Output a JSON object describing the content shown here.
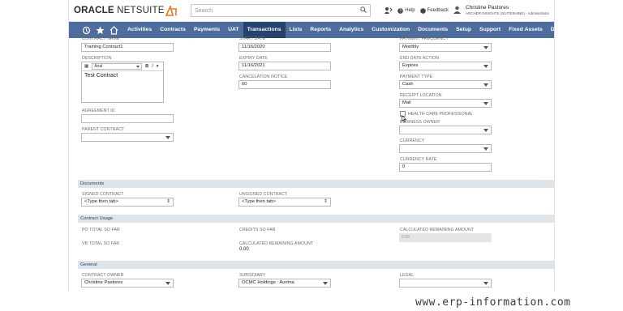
{
  "topbar": {
    "logo_main": "ORACLE",
    "logo_sub": "NETSUITE",
    "search_placeholder": "Search",
    "help_label": "Help",
    "feedback_label": "Feedback",
    "user_name": "Christine Pastores",
    "user_role": "ARCHER INSIGHTS (SUITESHINE) - Administrator"
  },
  "nav": {
    "items": [
      "Activities",
      "Contracts",
      "Payments",
      "UAT",
      "Transactions",
      "Lists",
      "Reports",
      "Analytics",
      "Customization",
      "Documents",
      "Setup",
      "Support",
      "Fixed Assets",
      "Demo Framework",
      "..."
    ],
    "active_index": 4,
    "colors": {
      "bar": "#4d6d9f",
      "active": "#26436e"
    }
  },
  "form": {
    "contract_name": {
      "label": "CONTRACT NAME",
      "value": "Training Contract1"
    },
    "description": {
      "label": "DESCRIPTION",
      "font": "Arial",
      "bold": "B",
      "italic": "I",
      "text": "Test Contract"
    },
    "agreement_id": {
      "label": "AGREEMENT ID",
      "value": ""
    },
    "parent_contract": {
      "label": "PARENT CONTRACT",
      "value": ""
    },
    "start_date": {
      "label": "START DATE",
      "value": "11/16/2020"
    },
    "expiry_date": {
      "label": "EXPIRY DATE",
      "value": "11/16/2021"
    },
    "cancelation_notice": {
      "label": "CANCELATION NOTICE",
      "value": "60"
    },
    "payment_frequency": {
      "label": "PAYMENT FREQUENCY",
      "value": "Monthly"
    },
    "end_date_action": {
      "label": "END DATE ACTION",
      "value": "Expires"
    },
    "payment_type": {
      "label": "PAYMENT TYPE",
      "value": "Cash"
    },
    "receipt_location": {
      "label": "RECEIPT LOCATION",
      "value": "Mail"
    },
    "health_care_professional": {
      "label": "HEALTH CARE PROFESSIONAL"
    },
    "business_owner": {
      "label": "BUSINESS OWNER",
      "value": ""
    },
    "currency": {
      "label": "CURRENCY",
      "value": ""
    },
    "currency_rate": {
      "label": "CURRENCY RATE",
      "value": "0"
    }
  },
  "documents": {
    "title": "Documents",
    "signed_contract": {
      "label": "SIGNED CONTRACT",
      "value": "<Type then tab>"
    },
    "unsigned_contract": {
      "label": "UNSIGNED CONTRACT",
      "value": "<Type then tab>"
    }
  },
  "contract_usage": {
    "title": "Contract Usage",
    "po_total": {
      "label": "PO TOTAL SO FAR"
    },
    "vb_total": {
      "label": "VB TOTAL SO FAR"
    },
    "credits": {
      "label": "CREDITS SO FAR"
    },
    "calc_remaining_1": {
      "label": "CALCULATED REMAINING AMOUNT",
      "value": "0.00"
    },
    "calc_remaining_2": {
      "label": "CALCULATED REMAINING AMOUNT",
      "value": "0.00"
    }
  },
  "general": {
    "title": "General",
    "contract_owner": {
      "label": "CONTRACT OWNER",
      "value": "Christine Pastores"
    },
    "subsidiary": {
      "label": "SUBSIDIARY",
      "value": "OCMC Holdings : Aurima"
    },
    "legal": {
      "label": "LEGAL",
      "value": ""
    }
  },
  "watermark": "www.erp-information.com"
}
